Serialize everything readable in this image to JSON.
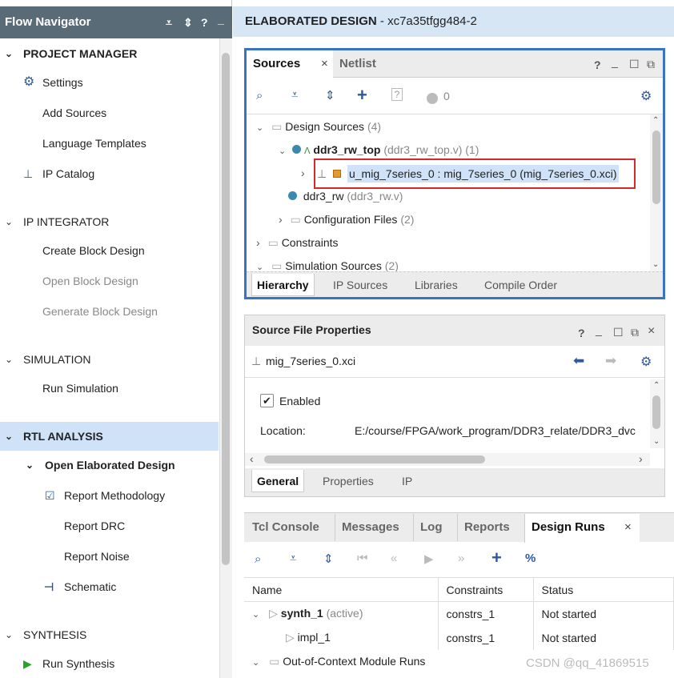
{
  "nav": {
    "title": "Flow Navigator",
    "controls": [
      "⩡",
      "⇕",
      "?",
      "_"
    ],
    "sections": {
      "project_manager": "PROJECT MANAGER",
      "ip_integrator": "IP INTEGRATOR",
      "simulation": "SIMULATION",
      "rtl_analysis": "RTL ANALYSIS",
      "synthesis": "SYNTHESIS"
    },
    "items": {
      "settings": "Settings",
      "add_sources": "Add Sources",
      "language_templates": "Language Templates",
      "ip_catalog": "IP Catalog",
      "create_block_design": "Create Block Design",
      "open_block_design": "Open Block Design",
      "generate_block_design": "Generate Block Design",
      "run_simulation": "Run Simulation",
      "open_elaborated_design": "Open Elaborated Design",
      "report_methodology": "Report Methodology",
      "report_drc": "Report DRC",
      "report_noise": "Report Noise",
      "schematic": "Schematic",
      "run_synthesis": "Run Synthesis"
    }
  },
  "header": {
    "title": "ELABORATED DESIGN",
    "subtitle": " - xc7a35tfgg484-2"
  },
  "sources": {
    "tabs": {
      "sources": "Sources",
      "netlist": "Netlist"
    },
    "badge": "0",
    "tree": {
      "design_sources": "Design Sources",
      "design_sources_count": "(4)",
      "top": "ddr3_rw_top",
      "top_file": "(ddr3_rw_top.v) (1)",
      "mig": "u_mig_7series_0 : mig_7series_0 (mig_7series_0.xci)",
      "ddr3_rw": "ddr3_rw",
      "ddr3_rw_file": "(ddr3_rw.v)",
      "config_files": "Configuration Files",
      "config_count": "(2)",
      "constraints": "Constraints",
      "sim_sources": "Simulation Sources",
      "sim_count": "(2)"
    },
    "bottom_tabs": {
      "hierarchy": "Hierarchy",
      "ip_sources": "IP Sources",
      "libraries": "Libraries",
      "compile_order": "Compile Order"
    }
  },
  "props": {
    "title": "Source File Properties",
    "file": "mig_7series_0.xci",
    "enabled": "Enabled",
    "location_label": "Location:",
    "location_value": "E:/course/FPGA/work_program/DDR3_relate/DDR3_dvc",
    "tabs": {
      "general": "General",
      "properties": "Properties",
      "ip": "IP"
    }
  },
  "runs": {
    "tabs": {
      "tcl": "Tcl Console",
      "messages": "Messages",
      "log": "Log",
      "reports": "Reports",
      "design_runs": "Design Runs"
    },
    "columns": {
      "name": "Name",
      "constraints": "Constraints",
      "status": "Status"
    },
    "rows": {
      "synth": "synth_1",
      "synth_active": "(active)",
      "synth_constr": "constrs_1",
      "synth_status": "Not started",
      "impl": "impl_1",
      "impl_constr": "constrs_1",
      "impl_status": "Not started",
      "ooc": "Out-of-Context Module Runs"
    }
  },
  "watermark": "CSDN @qq_41869515"
}
